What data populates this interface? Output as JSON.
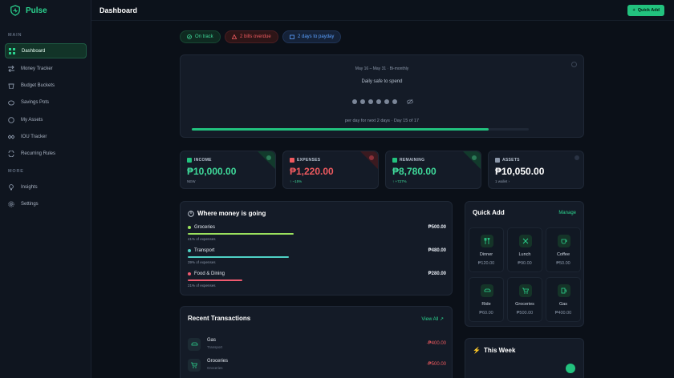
{
  "brand": {
    "name": "Pulse"
  },
  "sidebar": {
    "main_label": "MAIN",
    "more_label": "MORE",
    "items": [
      {
        "label": "Dashboard",
        "icon": "grid-icon"
      },
      {
        "label": "Money Tracker",
        "icon": "arrows-icon"
      },
      {
        "label": "Budget Buckets",
        "icon": "bucket-icon"
      },
      {
        "label": "Savings Pots",
        "icon": "piggy-icon"
      },
      {
        "label": "My Assets",
        "icon": "coin-icon"
      },
      {
        "label": "IOU Tracker",
        "icon": "handshake-icon"
      },
      {
        "label": "Recurring Rules",
        "icon": "repeat-icon"
      }
    ],
    "more_items": [
      {
        "label": "Insights",
        "icon": "bulb-icon"
      },
      {
        "label": "Settings",
        "icon": "gear-icon"
      }
    ]
  },
  "header": {
    "title": "Dashboard",
    "quick_add": "Quick Add"
  },
  "pills": {
    "on_track": "On track",
    "overdue": "2 bills overdue",
    "payday": "2 days to payday"
  },
  "hero": {
    "range": "May 16 – May 31",
    "period": "Bi-monthly",
    "title": "Daily safe to spend",
    "subtitle": "per day for next 2 days · Day 15 of 17",
    "progress": 0.88
  },
  "stats": {
    "income": {
      "label": "INCOME",
      "value": "₱10,000.00",
      "sub": "NEW"
    },
    "expenses": {
      "label": "EXPENSES",
      "value": "₱1,220.00",
      "sub": "↑ −15%"
    },
    "remaining": {
      "label": "REMAINING",
      "value": "₱8,780.00",
      "sub": "↑ +727%"
    },
    "assets": {
      "label": "ASSETS",
      "value": "₱10,050.00",
      "sub": "1 wallet ›"
    }
  },
  "where": {
    "title": "Where money is going",
    "categories": [
      {
        "name": "Groceries",
        "amount": "₱500.00",
        "pct_label": "41% of expenses",
        "pct": 0.41,
        "color": "#9be15d"
      },
      {
        "name": "Transport",
        "amount": "₱480.00",
        "pct_label": "39% of expenses",
        "pct": 0.39,
        "color": "#4fd1c5"
      },
      {
        "name": "Food & Dining",
        "amount": "₱280.00",
        "pct_label": "21% of expenses",
        "pct": 0.21,
        "color": "#ef5a6f"
      }
    ]
  },
  "recent": {
    "title": "Recent Transactions",
    "view_all": "View All ↗",
    "items": [
      {
        "name": "Gas",
        "category": "Transport",
        "amount": "-₱400.00"
      },
      {
        "name": "Groceries",
        "category": "Groceries",
        "amount": "-₱500.00"
      }
    ]
  },
  "quick_add": {
    "title": "Quick Add",
    "manage": "Manage",
    "tiles": [
      {
        "name": "Dinner",
        "amount": "₱120.00",
        "icon": "utensils-icon"
      },
      {
        "name": "Lunch",
        "amount": "₱90.00",
        "icon": "fork-knife-icon"
      },
      {
        "name": "Coffee",
        "amount": "₱50.00",
        "icon": "cup-icon"
      },
      {
        "name": "Ride",
        "amount": "₱60.00",
        "icon": "car-icon"
      },
      {
        "name": "Groceries",
        "amount": "₱500.00",
        "icon": "cart-icon"
      },
      {
        "name": "Gas",
        "amount": "₱400.00",
        "icon": "fuel-icon"
      }
    ]
  },
  "week": {
    "title": "This Week"
  },
  "colors": {
    "accent": "#22c27e",
    "danger": "#ef5a5f",
    "info": "#5aa0ff"
  }
}
